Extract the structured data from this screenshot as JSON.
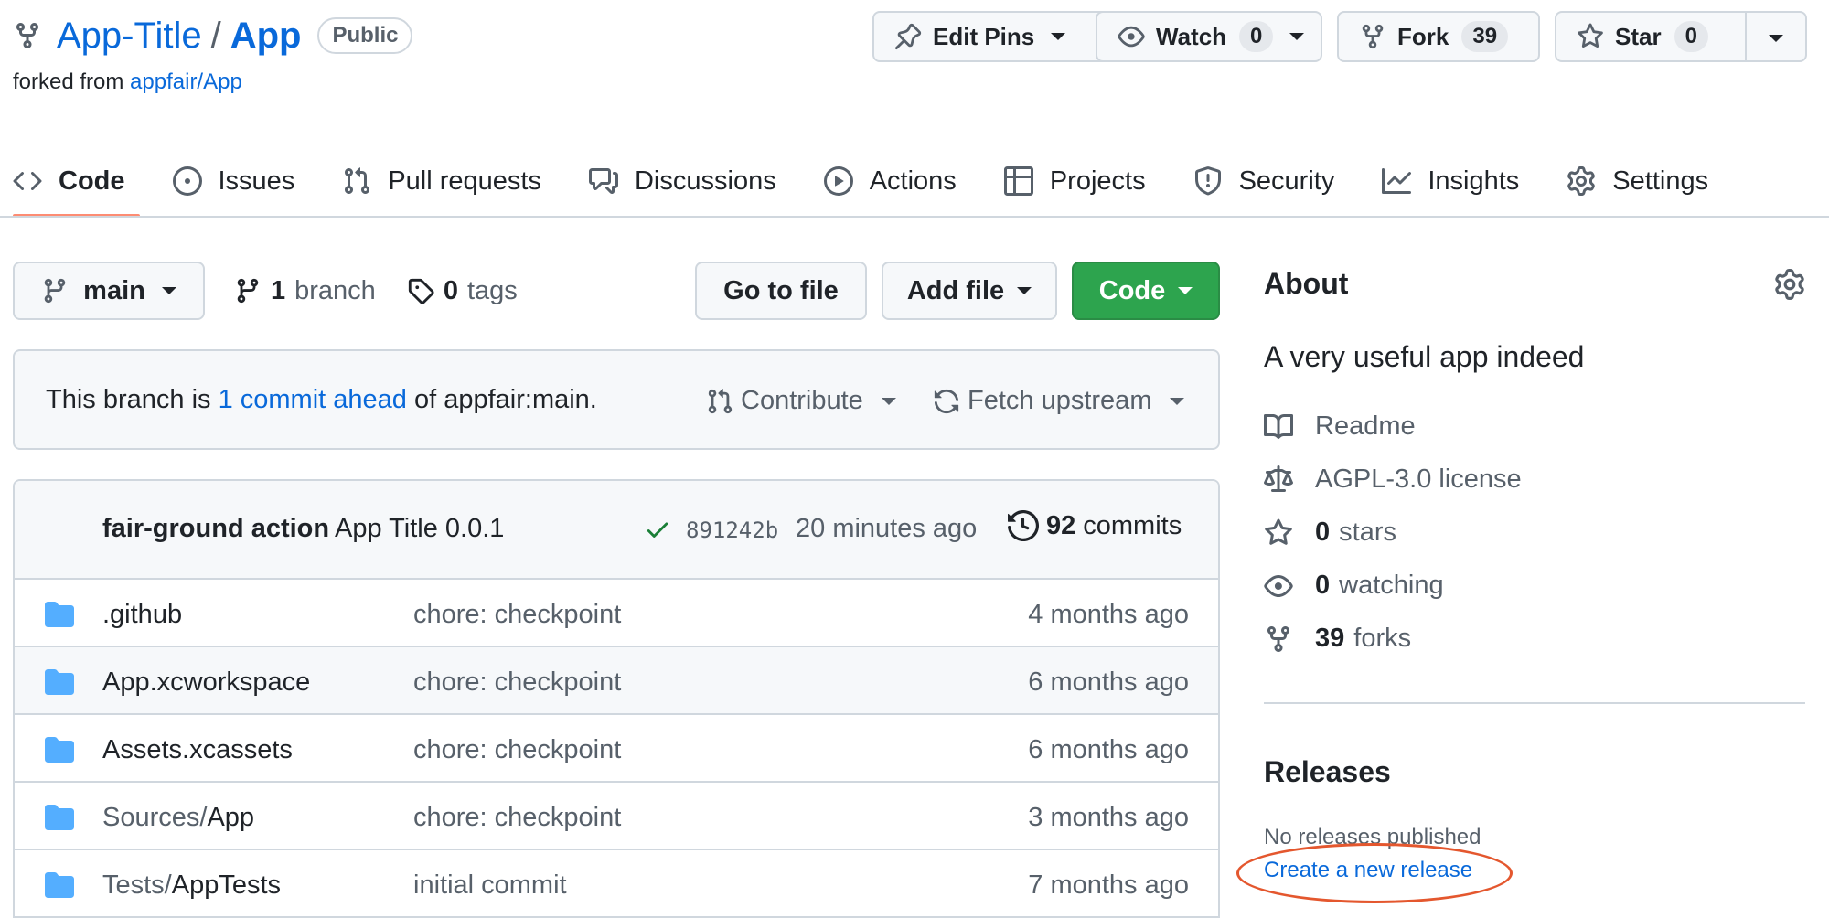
{
  "repo": {
    "owner": "App-Title",
    "separator": "/",
    "name": "App",
    "visibility": "Public",
    "forked_prefix": "forked from",
    "forked_source": "appfair/App"
  },
  "header_buttons": {
    "edit_pins": "Edit Pins",
    "watch": "Watch",
    "watch_count": "0",
    "fork": "Fork",
    "fork_count": "39",
    "star": "Star",
    "star_count": "0"
  },
  "tabs": [
    {
      "label": "Code",
      "icon": "code-icon",
      "active": true
    },
    {
      "label": "Issues",
      "icon": "issue-icon"
    },
    {
      "label": "Pull requests",
      "icon": "pull-request-icon"
    },
    {
      "label": "Discussions",
      "icon": "discussion-icon"
    },
    {
      "label": "Actions",
      "icon": "play-icon"
    },
    {
      "label": "Projects",
      "icon": "table-icon"
    },
    {
      "label": "Security",
      "icon": "shield-icon"
    },
    {
      "label": "Insights",
      "icon": "graph-icon"
    },
    {
      "label": "Settings",
      "icon": "gear-icon"
    }
  ],
  "branch_bar": {
    "branch": "main",
    "branch_count": "1",
    "branch_label": "branch",
    "tag_count": "0",
    "tag_label": "tags",
    "go_to_file": "Go to file",
    "add_file": "Add file",
    "code": "Code"
  },
  "ahead": {
    "prefix": "This branch is",
    "link": "1 commit ahead",
    "suffix": "of appfair:main.",
    "contribute": "Contribute",
    "fetch_upstream": "Fetch upstream"
  },
  "commit": {
    "author": "fair-ground action",
    "message": "App Title 0.0.1",
    "sha": "891242b",
    "when": "20 minutes ago",
    "count": "92",
    "count_label": "commits"
  },
  "files": [
    {
      "dim": "",
      "name": ".github",
      "message": "chore: checkpoint",
      "age": "4 months ago"
    },
    {
      "dim": "",
      "name": "App.xcworkspace",
      "message": "chore: checkpoint",
      "age": "6 months ago"
    },
    {
      "dim": "",
      "name": "Assets.xcassets",
      "message": "chore: checkpoint",
      "age": "6 months ago"
    },
    {
      "dim": "Sources/",
      "name": "App",
      "message": "chore: checkpoint",
      "age": "3 months ago"
    },
    {
      "dim": "Tests/",
      "name": "AppTests",
      "message": "initial commit",
      "age": "7 months ago"
    }
  ],
  "about": {
    "title": "About",
    "description": "A very useful app indeed",
    "readme": "Readme",
    "license": "AGPL-3.0 license",
    "stars_count": "0",
    "stars_label": "stars",
    "watching_count": "0",
    "watching_label": "watching",
    "forks_count": "39",
    "forks_label": "forks"
  },
  "releases": {
    "title": "Releases",
    "none": "No releases published",
    "create": "Create a new release"
  },
  "colors": {
    "accent_link": "#0969da",
    "tab_underline": "#fd8c73",
    "code_button": "#2da44e",
    "highlight_circle": "#e4572e",
    "folder": "#54aeff"
  }
}
